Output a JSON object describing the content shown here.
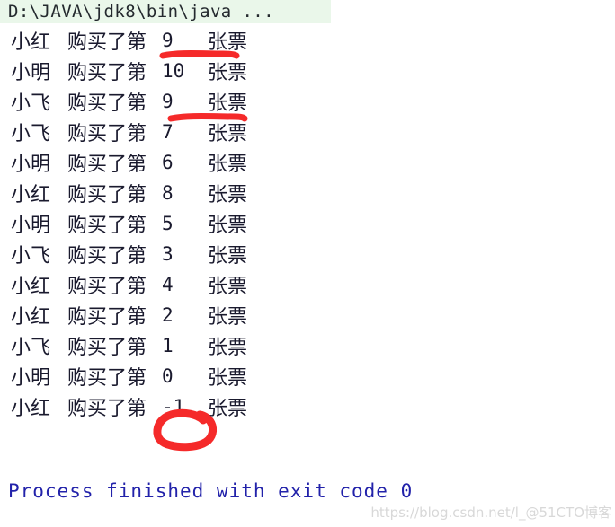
{
  "console": {
    "command_line": "D:\\JAVA\\jdk8\\bin\\java ...",
    "rows": [
      {
        "name": "小红",
        "mid": " 购买了第 ",
        "num": "9",
        "tail": " 张票"
      },
      {
        "name": "小明",
        "mid": " 购买了第 ",
        "num": "10",
        "tail": " 张票"
      },
      {
        "name": "小飞",
        "mid": " 购买了第 ",
        "num": "9",
        "tail": " 张票"
      },
      {
        "name": "小飞",
        "mid": " 购买了第 ",
        "num": "7",
        "tail": " 张票"
      },
      {
        "name": "小明",
        "mid": " 购买了第 ",
        "num": "6",
        "tail": " 张票"
      },
      {
        "name": "小红",
        "mid": " 购买了第 ",
        "num": "8",
        "tail": " 张票"
      },
      {
        "name": "小明",
        "mid": " 购买了第 ",
        "num": "5",
        "tail": " 张票"
      },
      {
        "name": "小飞",
        "mid": " 购买了第 ",
        "num": "3",
        "tail": " 张票"
      },
      {
        "name": "小红",
        "mid": " 购买了第 ",
        "num": "4",
        "tail": " 张票"
      },
      {
        "name": "小红",
        "mid": " 购买了第 ",
        "num": "2",
        "tail": " 张票"
      },
      {
        "name": "小飞",
        "mid": " 购买了第 ",
        "num": "1",
        "tail": " 张票"
      },
      {
        "name": "小明",
        "mid": " 购买了第 ",
        "num": "0",
        "tail": " 张票"
      },
      {
        "name": "小红",
        "mid": " 购买了第 ",
        "num": "-1",
        "tail": " 张票"
      }
    ],
    "exit_message": "Process finished with exit code 0"
  },
  "annotations": {
    "color": "#f52a2a",
    "underline_1_label": "red-underline-row-1",
    "underline_2_label": "red-underline-row-3",
    "circle_label": "red-circle-negative-one"
  },
  "watermark": {
    "text": "https://blog.csdn.net/l_@51CTO博客"
  },
  "colors": {
    "command_highlight_bg": "#eaf7ea",
    "console_text": "#1a1a2e",
    "exit_text": "#2222aa",
    "annotation_red": "#f52a2a",
    "watermark_gray": "#d8d8d8"
  }
}
